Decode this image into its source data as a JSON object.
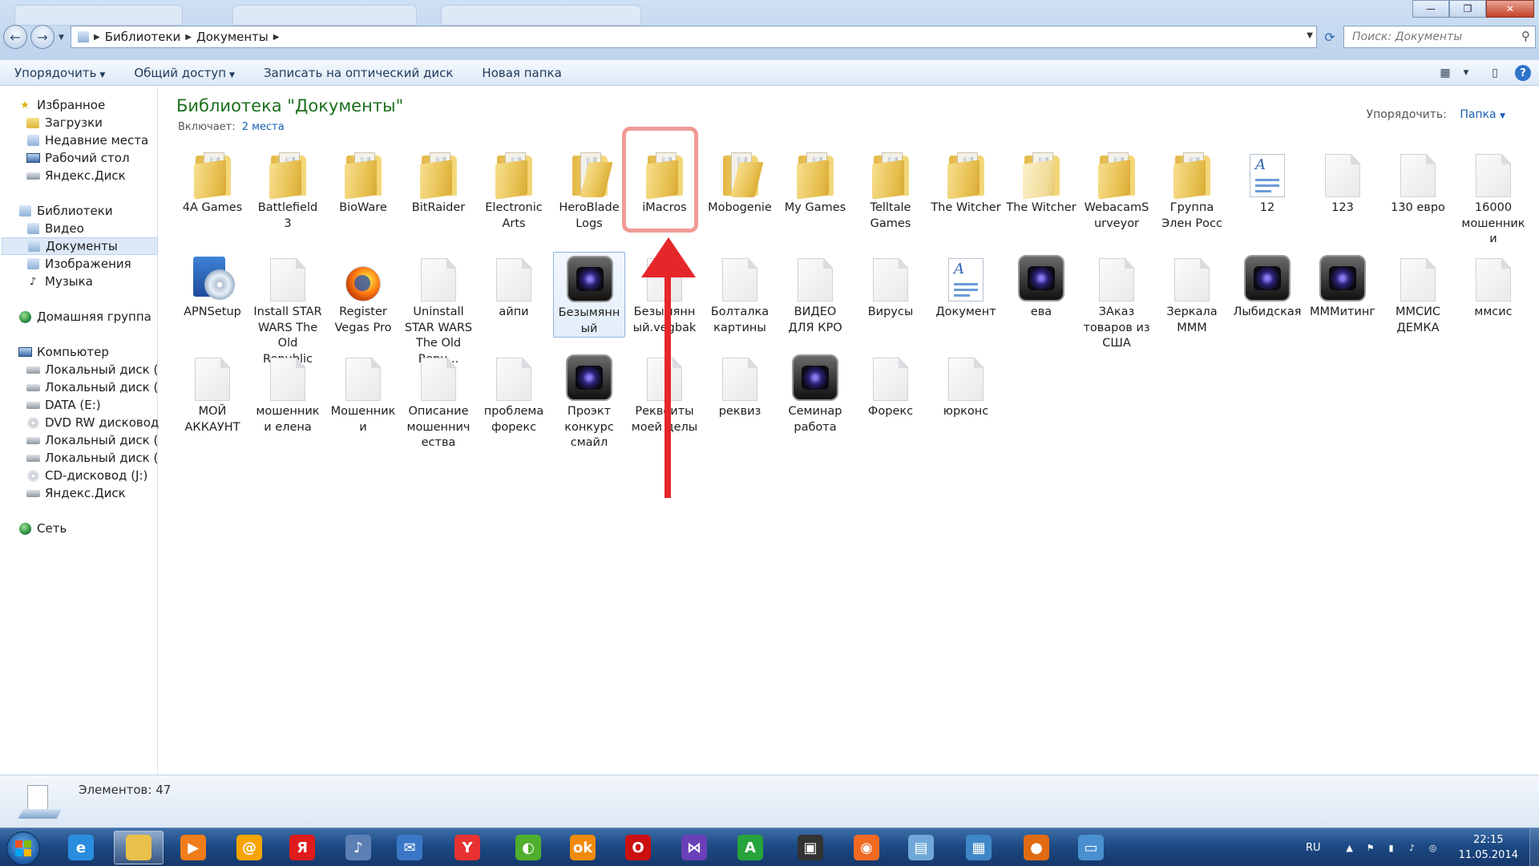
{
  "window": {
    "minimize_glyph": "—",
    "maximize_glyph": "❐",
    "close_glyph": "✕"
  },
  "address": {
    "crumbs": [
      "Библиотеки",
      "Документы"
    ],
    "search_placeholder": "Поиск: Документы"
  },
  "toolbar": {
    "organize": "Упорядочить",
    "share": "Общий доступ",
    "burn": "Записать на оптический диск",
    "new_folder": "Новая папка"
  },
  "nav": {
    "favorites": "Избранное",
    "downloads": "Загрузки",
    "recent": "Недавние места",
    "desktop": "Рабочий стол",
    "yadisk": "Яндекс.Диск",
    "libraries": "Библиотеки",
    "video": "Видео",
    "documents": "Документы",
    "images": "Изображения",
    "music": "Музыка",
    "homegroup": "Домашняя группа",
    "computer": "Компьютер",
    "disk_c": "Локальный диск (C:",
    "disk_d": "Локальный диск (D:",
    "data_e": "DATA (E:)",
    "dvd": "DVD RW дисковод (",
    "disk_h": "Локальный диск (H:",
    "disk_i": "Локальный диск (I:)",
    "cd_j": "CD-дисковод (J:)",
    "yadisk2": "Яндекс.Диск",
    "network": "Сеть"
  },
  "library": {
    "title": "Библиотека \"Документы\"",
    "includes_label": "Включает:",
    "includes_link": "2 места",
    "sort_label": "Упорядочить:",
    "sort_value": "Папка"
  },
  "items": [
    {
      "label": "4A Games",
      "type": "folder"
    },
    {
      "label": "Battlefield 3",
      "type": "folder"
    },
    {
      "label": "BioWare",
      "type": "folder"
    },
    {
      "label": "BitRaider",
      "type": "folder"
    },
    {
      "label": "Electronic Arts",
      "type": "folder"
    },
    {
      "label": "HeroBlade Logs",
      "type": "folder-open"
    },
    {
      "label": "iMacros",
      "type": "folder"
    },
    {
      "label": "Mobogenie",
      "type": "folder-open"
    },
    {
      "label": "My Games",
      "type": "folder"
    },
    {
      "label": "Telltale Games",
      "type": "folder"
    },
    {
      "label": "The Witcher",
      "type": "folder"
    },
    {
      "label": "The Witcher",
      "type": "folder-light"
    },
    {
      "label": "WebacamS urveyor",
      "type": "folder"
    },
    {
      "label": "Группа Элен Росс",
      "type": "folder"
    },
    {
      "label": "12",
      "type": "doc"
    },
    {
      "label": "123",
      "type": "file"
    },
    {
      "label": "130 евро",
      "type": "file"
    },
    {
      "label": "16000 мошенник и",
      "type": "file"
    },
    {
      "label": "APNSetup",
      "type": "apn"
    },
    {
      "label": "Install STAR WARS The Old Republic",
      "type": "file"
    },
    {
      "label": "Register Vegas Pro",
      "type": "firefox"
    },
    {
      "label": "Uninstall STAR WARS The Old Repu...",
      "type": "file"
    },
    {
      "label": "айпи",
      "type": "file"
    },
    {
      "label": "Безымянн ый",
      "type": "video",
      "selected": true
    },
    {
      "label": "Безымянн ый.vegbak",
      "type": "file"
    },
    {
      "label": "Болталка картины",
      "type": "file"
    },
    {
      "label": "ВИДЕО ДЛЯ КРО",
      "type": "file"
    },
    {
      "label": "Вирусы",
      "type": "file"
    },
    {
      "label": "Документ",
      "type": "doc"
    },
    {
      "label": "ева",
      "type": "video"
    },
    {
      "label": "ЗАказ товаров из США",
      "type": "file"
    },
    {
      "label": "Зеркала МММ",
      "type": "file"
    },
    {
      "label": "Лыбидская",
      "type": "video"
    },
    {
      "label": "МММитинг",
      "type": "video"
    },
    {
      "label": "ММСИС ДЕМКА",
      "type": "file"
    },
    {
      "label": "ммсис",
      "type": "file"
    },
    {
      "label": "МОЙ АККАУНТ",
      "type": "file"
    },
    {
      "label": "мошенник и елена",
      "type": "file"
    },
    {
      "label": "Мошенник и",
      "type": "file"
    },
    {
      "label": "Описание мошеннич ества",
      "type": "file"
    },
    {
      "label": "проблема форекс",
      "type": "file"
    },
    {
      "label": "Проэкт конкурс смайл",
      "type": "video"
    },
    {
      "label": "Реквеиты моей делы",
      "type": "file"
    },
    {
      "label": "реквиз",
      "type": "file"
    },
    {
      "label": "Семинар работа",
      "type": "video"
    },
    {
      "label": "Форекс",
      "type": "file"
    },
    {
      "label": "юрконс",
      "type": "file"
    }
  ],
  "details": {
    "count": "Элементов: 47"
  },
  "taskbar": {
    "apps": [
      {
        "name": "ie",
        "color": "#2b8de0",
        "glyph": "e"
      },
      {
        "name": "explorer",
        "color": "#e9c14a",
        "glyph": ""
      },
      {
        "name": "media-player",
        "color": "#f07c1a",
        "glyph": "▶"
      },
      {
        "name": "mail-ru-agent",
        "color": "#f7a400",
        "glyph": "@"
      },
      {
        "name": "yandex",
        "color": "#e01b1b",
        "glyph": "Я"
      },
      {
        "name": "volume",
        "color": "#5c7fb4",
        "glyph": "♪"
      },
      {
        "name": "mail",
        "color": "#3a78c7",
        "glyph": "✉"
      },
      {
        "name": "yandex-browser",
        "color": "#e83232",
        "glyph": "Y"
      },
      {
        "name": "green-app",
        "color": "#4fae2d",
        "glyph": "◐"
      },
      {
        "name": "odnoklassniki",
        "color": "#f08a0c",
        "glyph": "ok"
      },
      {
        "name": "opera",
        "color": "#cc1010",
        "glyph": "O"
      },
      {
        "name": "visual-studio",
        "color": "#6a3fb8",
        "glyph": "⋈"
      },
      {
        "name": "a-app",
        "color": "#27a33b",
        "glyph": "A"
      },
      {
        "name": "camera",
        "color": "#333333",
        "glyph": "▣"
      },
      {
        "name": "origin",
        "color": "#f26a22",
        "glyph": "◉"
      },
      {
        "name": "notes",
        "color": "#6fa8d8",
        "glyph": "▤"
      },
      {
        "name": "photo-viewer",
        "color": "#3e86c7",
        "glyph": "▦"
      },
      {
        "name": "firefox",
        "color": "#e06b12",
        "glyph": "●"
      },
      {
        "name": "remote-desktop",
        "color": "#4a90d0",
        "glyph": "▭"
      }
    ],
    "lang": "RU",
    "time": "22:15",
    "date": "11.05.2014"
  }
}
